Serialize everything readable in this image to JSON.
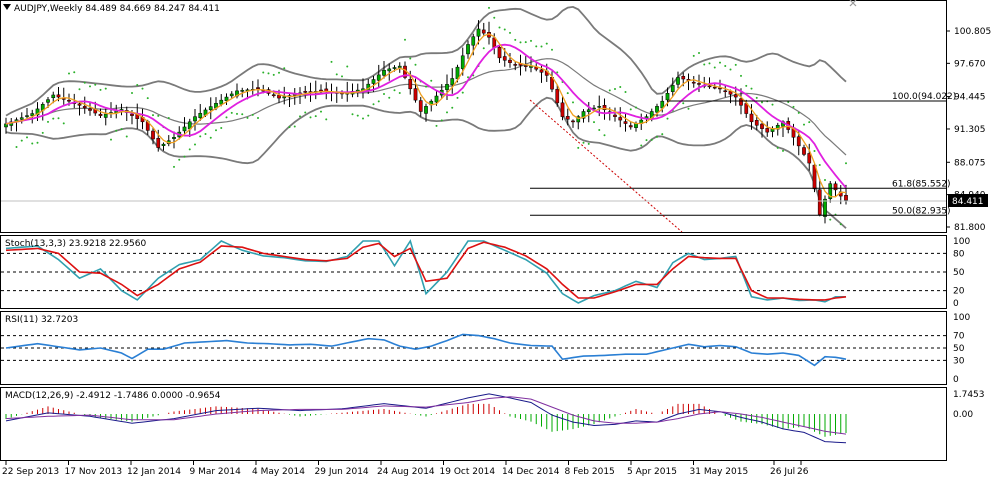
{
  "header": {
    "symbol_line": "AUDJPY,Weekly  84.489 84.669 84.247 84.411"
  },
  "icons": {
    "menu": "menu-arrow-icon"
  },
  "price_axis": {
    "ticks": [
      "100.805",
      "97.670",
      "94.445",
      "91.305",
      "88.075",
      "84.940",
      "81.800"
    ],
    "current_price": "84.411"
  },
  "fib_levels": [
    {
      "label": "100.0(94.022)",
      "value": 94.022
    },
    {
      "label": "61.8(85.552)",
      "value": 85.552
    },
    {
      "label": "50.0(82.935)",
      "value": 82.935
    }
  ],
  "stoch": {
    "label": "Stoch(13,3,3) 23.9218 22.9560",
    "ticks": [
      "100",
      "80",
      "50",
      "20",
      "0"
    ]
  },
  "rsi": {
    "label": "RSI(11) 32.7203",
    "ticks": [
      "100",
      "70",
      "50",
      "30",
      "0"
    ]
  },
  "macd": {
    "label": "MACD(12,26,9) -2.4912 -1.7486 0.0000 -0.9654",
    "ticks": [
      "1.7453",
      "0.00"
    ]
  },
  "time_axis": [
    "22 Sep 2013",
    "17 Nov 2013",
    "12 Jan 2014",
    "9 Mar 2014",
    "4 May 2014",
    "29 Jun 2014",
    "24 Aug 2014",
    "19 Oct 2014",
    "14 Dec 2014",
    "8 Feb 2015",
    "5 Apr 2015",
    "31 May 2015",
    "26 Jul",
    "26"
  ],
  "colors": {
    "bull": "#00aa00",
    "bear": "#cc0000",
    "ma_fast": "#f0a020",
    "ma_slow": "#e020e0",
    "bands": "#7a7a7a",
    "sar": "#2ab02a",
    "stoch_main": "#30a0b0",
    "stoch_signal": "#dd1111",
    "rsi": "#2a7fd4",
    "macd_line": "#1a1a8a",
    "macd_signal": "#8030a0"
  },
  "chart_data": {
    "type": "candlestick",
    "timeframe": "Weekly",
    "symbol": "AUDJPY",
    "anchors": [
      [
        0,
        91.8
      ],
      [
        5,
        92.8
      ],
      [
        9,
        94.6
      ],
      [
        14,
        93.6
      ],
      [
        18,
        92.6
      ],
      [
        22,
        93.2
      ],
      [
        26,
        92.0
      ],
      [
        29,
        89.5
      ],
      [
        32,
        90.5
      ],
      [
        36,
        92.5
      ],
      [
        40,
        93.8
      ],
      [
        44,
        95.0
      ],
      [
        48,
        95.2
      ],
      [
        52,
        94.3
      ],
      [
        56,
        94.8
      ],
      [
        60,
        95.0
      ],
      [
        64,
        94.7
      ],
      [
        68,
        95.2
      ],
      [
        72,
        97.0
      ],
      [
        75,
        97.4
      ],
      [
        79,
        93.0
      ],
      [
        82,
        94.5
      ],
      [
        85,
        96.2
      ],
      [
        88,
        99.5
      ],
      [
        90,
        101.0
      ],
      [
        92,
        100.2
      ],
      [
        94,
        98.2
      ],
      [
        97,
        97.5
      ],
      [
        100,
        97.4
      ],
      [
        103,
        96.5
      ],
      [
        106,
        92.5
      ],
      [
        108,
        92.0
      ],
      [
        110,
        93.0
      ],
      [
        113,
        93.5
      ],
      [
        116,
        92.5
      ],
      [
        119,
        91.5
      ],
      [
        122,
        92.5
      ],
      [
        125,
        94.0
      ],
      [
        128,
        96.3
      ],
      [
        130,
        96.0
      ],
      [
        133,
        95.5
      ],
      [
        136,
        95.2
      ],
      [
        139,
        94.4
      ],
      [
        142,
        92.0
      ],
      [
        145,
        91.0
      ],
      [
        148,
        92.0
      ],
      [
        150,
        90.5
      ],
      [
        153,
        88.0
      ],
      [
        155,
        83.0
      ],
      [
        157,
        86.0
      ],
      [
        159,
        84.8
      ],
      [
        160,
        84.4
      ]
    ],
    "stoch_main_anchors": [
      [
        0,
        88
      ],
      [
        6,
        92
      ],
      [
        10,
        70
      ],
      [
        14,
        40
      ],
      [
        18,
        55
      ],
      [
        22,
        20
      ],
      [
        25,
        5
      ],
      [
        29,
        40
      ],
      [
        33,
        62
      ],
      [
        37,
        70
      ],
      [
        41,
        100
      ],
      [
        45,
        85
      ],
      [
        49,
        76
      ],
      [
        53,
        73
      ],
      [
        57,
        68
      ],
      [
        61,
        67
      ],
      [
        65,
        75
      ],
      [
        68,
        100
      ],
      [
        71,
        100
      ],
      [
        74,
        60
      ],
      [
        77,
        100
      ],
      [
        80,
        15
      ],
      [
        84,
        50
      ],
      [
        88,
        100
      ],
      [
        91,
        100
      ],
      [
        95,
        85
      ],
      [
        99,
        70
      ],
      [
        103,
        48
      ],
      [
        106,
        15
      ],
      [
        109,
        0
      ],
      [
        112,
        12
      ],
      [
        116,
        20
      ],
      [
        120,
        35
      ],
      [
        124,
        25
      ],
      [
        127,
        65
      ],
      [
        130,
        80
      ],
      [
        133,
        70
      ],
      [
        136,
        72
      ],
      [
        139,
        75
      ],
      [
        142,
        10
      ],
      [
        145,
        5
      ],
      [
        148,
        8
      ],
      [
        151,
        4
      ],
      [
        154,
        5
      ],
      [
        156,
        2
      ],
      [
        158,
        10
      ],
      [
        160,
        10
      ]
    ],
    "stoch_signal_anchors": [
      [
        0,
        85
      ],
      [
        6,
        88
      ],
      [
        10,
        80
      ],
      [
        14,
        50
      ],
      [
        18,
        48
      ],
      [
        22,
        30
      ],
      [
        25,
        12
      ],
      [
        29,
        30
      ],
      [
        33,
        55
      ],
      [
        37,
        66
      ],
      [
        41,
        92
      ],
      [
        45,
        90
      ],
      [
        49,
        80
      ],
      [
        53,
        75
      ],
      [
        57,
        70
      ],
      [
        61,
        68
      ],
      [
        65,
        72
      ],
      [
        68,
        90
      ],
      [
        71,
        96
      ],
      [
        74,
        75
      ],
      [
        77,
        88
      ],
      [
        80,
        35
      ],
      [
        84,
        40
      ],
      [
        88,
        88
      ],
      [
        91,
        98
      ],
      [
        95,
        90
      ],
      [
        99,
        76
      ],
      [
        103,
        55
      ],
      [
        106,
        30
      ],
      [
        109,
        8
      ],
      [
        112,
        8
      ],
      [
        116,
        18
      ],
      [
        120,
        30
      ],
      [
        124,
        30
      ],
      [
        127,
        55
      ],
      [
        130,
        75
      ],
      [
        133,
        73
      ],
      [
        136,
        72
      ],
      [
        139,
        72
      ],
      [
        142,
        20
      ],
      [
        145,
        8
      ],
      [
        148,
        8
      ],
      [
        151,
        6
      ],
      [
        154,
        5
      ],
      [
        156,
        5
      ],
      [
        158,
        8
      ],
      [
        160,
        10
      ]
    ],
    "rsi_anchors": [
      [
        0,
        50
      ],
      [
        6,
        57
      ],
      [
        10,
        52
      ],
      [
        14,
        47
      ],
      [
        18,
        50
      ],
      [
        22,
        42
      ],
      [
        24,
        33
      ],
      [
        27,
        48
      ],
      [
        30,
        48
      ],
      [
        34,
        58
      ],
      [
        38,
        60
      ],
      [
        42,
        62
      ],
      [
        46,
        58
      ],
      [
        50,
        57
      ],
      [
        54,
        55
      ],
      [
        58,
        56
      ],
      [
        62,
        53
      ],
      [
        66,
        60
      ],
      [
        69,
        65
      ],
      [
        72,
        63
      ],
      [
        75,
        53
      ],
      [
        78,
        48
      ],
      [
        81,
        53
      ],
      [
        84,
        62
      ],
      [
        87,
        72
      ],
      [
        90,
        70
      ],
      [
        93,
        65
      ],
      [
        96,
        58
      ],
      [
        100,
        54
      ],
      [
        104,
        53
      ],
      [
        106,
        32
      ],
      [
        110,
        37
      ],
      [
        114,
        38
      ],
      [
        118,
        40
      ],
      [
        122,
        40
      ],
      [
        126,
        48
      ],
      [
        130,
        56
      ],
      [
        133,
        52
      ],
      [
        136,
        54
      ],
      [
        139,
        52
      ],
      [
        142,
        42
      ],
      [
        145,
        40
      ],
      [
        148,
        42
      ],
      [
        151,
        38
      ],
      [
        154,
        22
      ],
      [
        156,
        36
      ],
      [
        158,
        35
      ],
      [
        160,
        32
      ]
    ],
    "macd_anchors": [
      [
        0,
        -0.6
      ],
      [
        8,
        0.1
      ],
      [
        16,
        -0.2
      ],
      [
        24,
        -0.8
      ],
      [
        32,
        -0.4
      ],
      [
        40,
        0.3
      ],
      [
        48,
        0.5
      ],
      [
        56,
        0.3
      ],
      [
        64,
        0.45
      ],
      [
        72,
        0.9
      ],
      [
        80,
        0.5
      ],
      [
        88,
        1.4
      ],
      [
        92,
        1.75
      ],
      [
        96,
        1.4
      ],
      [
        100,
        1.0
      ],
      [
        104,
        -0.1
      ],
      [
        108,
        -0.7
      ],
      [
        112,
        -1.0
      ],
      [
        116,
        -0.9
      ],
      [
        120,
        -0.6
      ],
      [
        124,
        -0.7
      ],
      [
        128,
        0.0
      ],
      [
        132,
        0.4
      ],
      [
        136,
        0.2
      ],
      [
        140,
        -0.3
      ],
      [
        144,
        -0.7
      ],
      [
        148,
        -1.3
      ],
      [
        152,
        -1.6
      ],
      [
        156,
        -2.4
      ],
      [
        160,
        -2.5
      ]
    ],
    "macd_signal_anchors": [
      [
        0,
        -0.4
      ],
      [
        8,
        -0.2
      ],
      [
        16,
        -0.1
      ],
      [
        24,
        -0.5
      ],
      [
        32,
        -0.5
      ],
      [
        40,
        0.0
      ],
      [
        48,
        0.3
      ],
      [
        56,
        0.4
      ],
      [
        64,
        0.4
      ],
      [
        72,
        0.7
      ],
      [
        80,
        0.6
      ],
      [
        88,
        1.0
      ],
      [
        92,
        1.35
      ],
      [
        96,
        1.5
      ],
      [
        100,
        1.3
      ],
      [
        104,
        0.6
      ],
      [
        108,
        -0.1
      ],
      [
        112,
        -0.6
      ],
      [
        116,
        -0.8
      ],
      [
        120,
        -0.8
      ],
      [
        124,
        -0.7
      ],
      [
        128,
        -0.4
      ],
      [
        132,
        0.0
      ],
      [
        136,
        0.2
      ],
      [
        140,
        0.0
      ],
      [
        144,
        -0.3
      ],
      [
        148,
        -0.7
      ],
      [
        152,
        -1.1
      ],
      [
        156,
        -1.5
      ],
      [
        160,
        -1.75
      ]
    ]
  }
}
